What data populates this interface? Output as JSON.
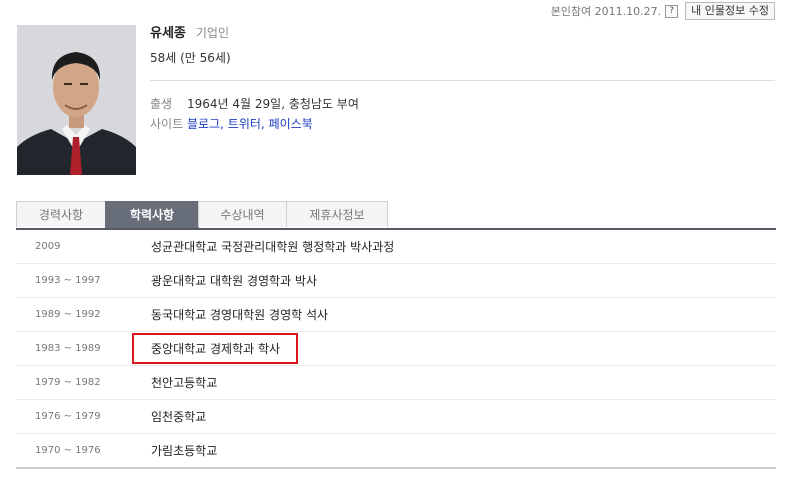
{
  "topbar": {
    "self_confirm": "본인참여 2011.10.27.",
    "help_icon_text": "?",
    "edit_label": "내 인물정보 수정"
  },
  "profile": {
    "name": "유세종",
    "role": "기업인",
    "age": "58세 (만 56세)",
    "birth_label": "출생",
    "birth_value": "1964년 4월 29일, 충청남도 부여",
    "site_label": "사이트",
    "sites": [
      "블로그",
      "트위터",
      "페이스북"
    ],
    "site_separator": ","
  },
  "tabs": [
    {
      "label": "경력사항",
      "active": false
    },
    {
      "label": "학력사항",
      "active": true
    },
    {
      "label": "수상내역",
      "active": false
    },
    {
      "label": "제휴사정보",
      "active": false
    }
  ],
  "education": [
    {
      "period": "2009",
      "school": "성균관대학교 국정관리대학원 행정학과 박사과정"
    },
    {
      "period": "1993 ~ 1997",
      "school": "광운대학교 대학원 경영학과 박사"
    },
    {
      "period": "1989 ~ 1992",
      "school": "동국대학교 경영대학원 경영학 석사"
    },
    {
      "period": "1983 ~ 1989",
      "school": "중앙대학교 경제학과 학사",
      "highlighted": true
    },
    {
      "period": "1979 ~ 1982",
      "school": "천안고등학교"
    },
    {
      "period": "1976 ~ 1979",
      "school": "임천중학교"
    },
    {
      "period": "1970 ~ 1976",
      "school": "가림초등학교"
    }
  ],
  "colors": {
    "active_tab": "#676d79",
    "link": "#1a3dc1",
    "highlight": "#d9171c"
  }
}
